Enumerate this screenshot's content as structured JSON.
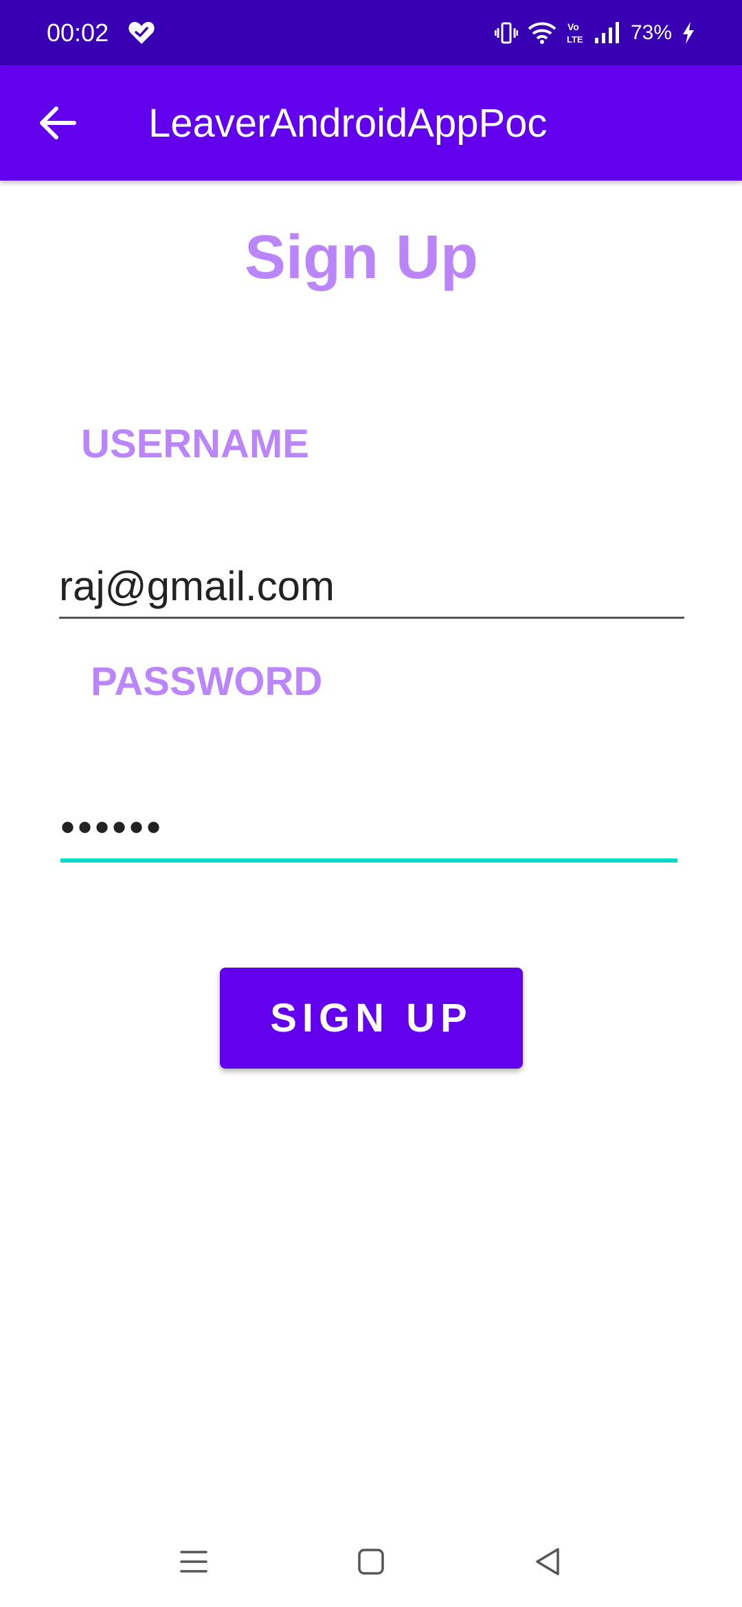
{
  "status_bar": {
    "time": "00:02",
    "battery": "73%",
    "icons": [
      "heart-check-icon",
      "vibrate-icon",
      "wifi-icon",
      "volte-icon",
      "signal-icon",
      "charging-icon"
    ]
  },
  "app_bar": {
    "title": "LeaverAndroidAppPoc",
    "back_icon": "arrow-back-icon"
  },
  "form": {
    "title": "Sign Up",
    "username_label": "USERNAME",
    "username_value": "raj@gmail.com",
    "password_label": "PASSWORD",
    "password_value": "••••••",
    "submit_label": "SIGN UP"
  },
  "nav_bar": {
    "icons": [
      "menu-icon",
      "home-icon",
      "back-icon"
    ]
  },
  "colors": {
    "status_bar": "#3700b3",
    "app_bar": "#6200ee",
    "accent_label": "#bb86fc",
    "input_focus_underline": "#03dac5",
    "button": "#6200ee"
  }
}
